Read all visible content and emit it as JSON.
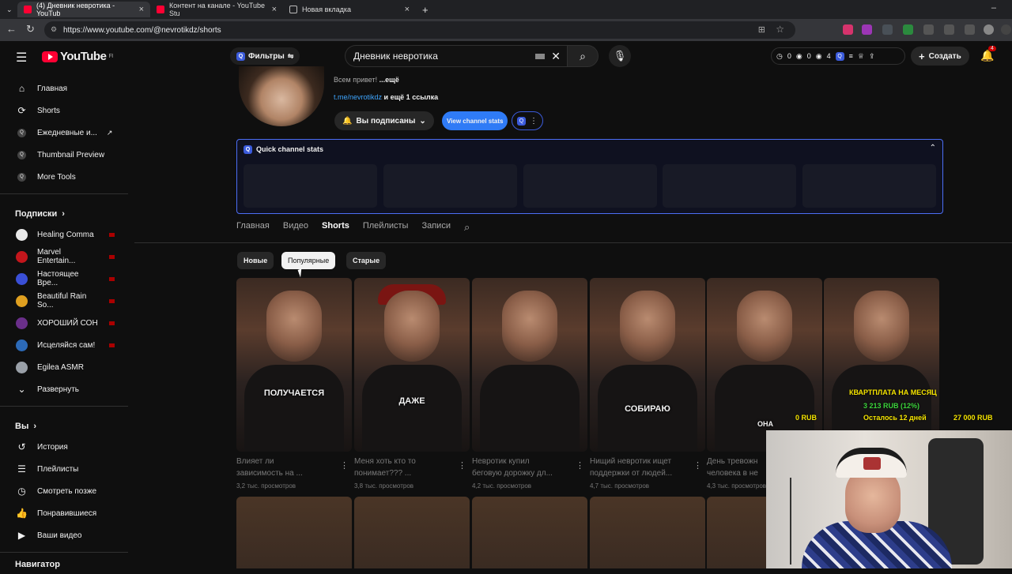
{
  "browser": {
    "tabs": [
      {
        "label": "(4) Дневник невротика - YouTub",
        "active": true
      },
      {
        "label": "Контент на канале - YouTube Stu",
        "active": false
      },
      {
        "label": "Новая вкладка",
        "active": false
      }
    ],
    "url": "https://www.youtube.com/@nevrotikdz/shorts"
  },
  "header": {
    "logo_text": "YouTube",
    "logo_region": "FI",
    "filters_label": "Фильтры",
    "search_value": "Дневник невротика",
    "stats": [
      "0",
      "0",
      "4"
    ],
    "create_label": "Создать",
    "notifications_count": "4"
  },
  "sidebar": {
    "main": [
      {
        "label": "Главная",
        "icon": "home-icon"
      },
      {
        "label": "Shorts",
        "icon": "shorts-icon"
      },
      {
        "label": "Ежедневные и...",
        "icon": "extension-icon"
      },
      {
        "label": "Thumbnail Preview",
        "icon": "extension-icon"
      },
      {
        "label": "More Tools",
        "icon": "extension-icon"
      }
    ],
    "subscriptions_title": "Подписки",
    "subscriptions": [
      {
        "label": "Healing Comma",
        "color": "#e8e8e8"
      },
      {
        "label": "Marvel Entertain...",
        "color": "#c4161c"
      },
      {
        "label": "Настоящее Вре...",
        "color": "#3a4fd6"
      },
      {
        "label": "Beautiful Rain So...",
        "color": "#e0a020"
      },
      {
        "label": "ХОРОШИЙ СОН",
        "color": "#6a2f8a"
      },
      {
        "label": "Исцеляйся сам!",
        "color": "#2c6ab8"
      },
      {
        "label": "Egilea ASMR",
        "color": "#9aa0a8"
      }
    ],
    "expand_label": "Развернуть",
    "you_title": "Вы",
    "you": [
      {
        "label": "История",
        "icon": "history-icon"
      },
      {
        "label": "Плейлисты",
        "icon": "playlists-icon"
      },
      {
        "label": "Смотреть позже",
        "icon": "watch-later-icon"
      },
      {
        "label": "Понравившиеся",
        "icon": "like-icon"
      },
      {
        "label": "Ваши видео",
        "icon": "your-videos-icon"
      }
    ],
    "navigator_title": "Навигатор"
  },
  "channel": {
    "description_prefix": "Всем привет!",
    "description_more": "...ещё",
    "link": "t.me/nevrotikdz",
    "link_more": "и ещё 1 ссылка",
    "subscribed_label": "Вы подписаны",
    "view_stats_label": "View channel stats",
    "quick_stats_title": "Quick channel stats"
  },
  "tabs": [
    "Главная",
    "Видео",
    "Shorts",
    "Плейлисты",
    "Записи"
  ],
  "active_tab": "Shorts",
  "chips": [
    "Новые",
    "Популярные",
    "Старые"
  ],
  "active_chip": "Популярные",
  "shorts": [
    {
      "title1": "Влияет ли",
      "title2": "зависимость на ...",
      "views": "3,2 тыс. просмотров",
      "overlay": "ПОЛУЧАЕТСЯ"
    },
    {
      "title1": "Меня хоть кто то",
      "title2": "понимает??? ...",
      "views": "3,8 тыс. просмотров",
      "overlay": "ДАЖЕ"
    },
    {
      "title1": "Невротик купил",
      "title2": "беговую дорожку дл...",
      "views": "4,2 тыс. просмотров",
      "overlay": ""
    },
    {
      "title1": "Нищий невротик ищет",
      "title2": "поддержки от людей...",
      "views": "4,7 тыс. просмотров",
      "overlay": "СОБИРАЮ"
    },
    {
      "title1": "День тревожн",
      "title2": "человека в не",
      "views": "4,3 тыс. просмотров",
      "overlay": "ОНА"
    },
    {
      "title1": "",
      "title2": "",
      "views": "",
      "overlay": ""
    }
  ],
  "stream_overlay": {
    "title": "КВАРТПЛАТА НА МЕСЯЦ",
    "amount": "3 213 RUB (12%)",
    "start": "0 RUB",
    "remaining": "Осталось 12 дней",
    "goal": "27 000 RUB",
    "title_color": "#f5e400",
    "amount_color": "#3cd43c"
  }
}
